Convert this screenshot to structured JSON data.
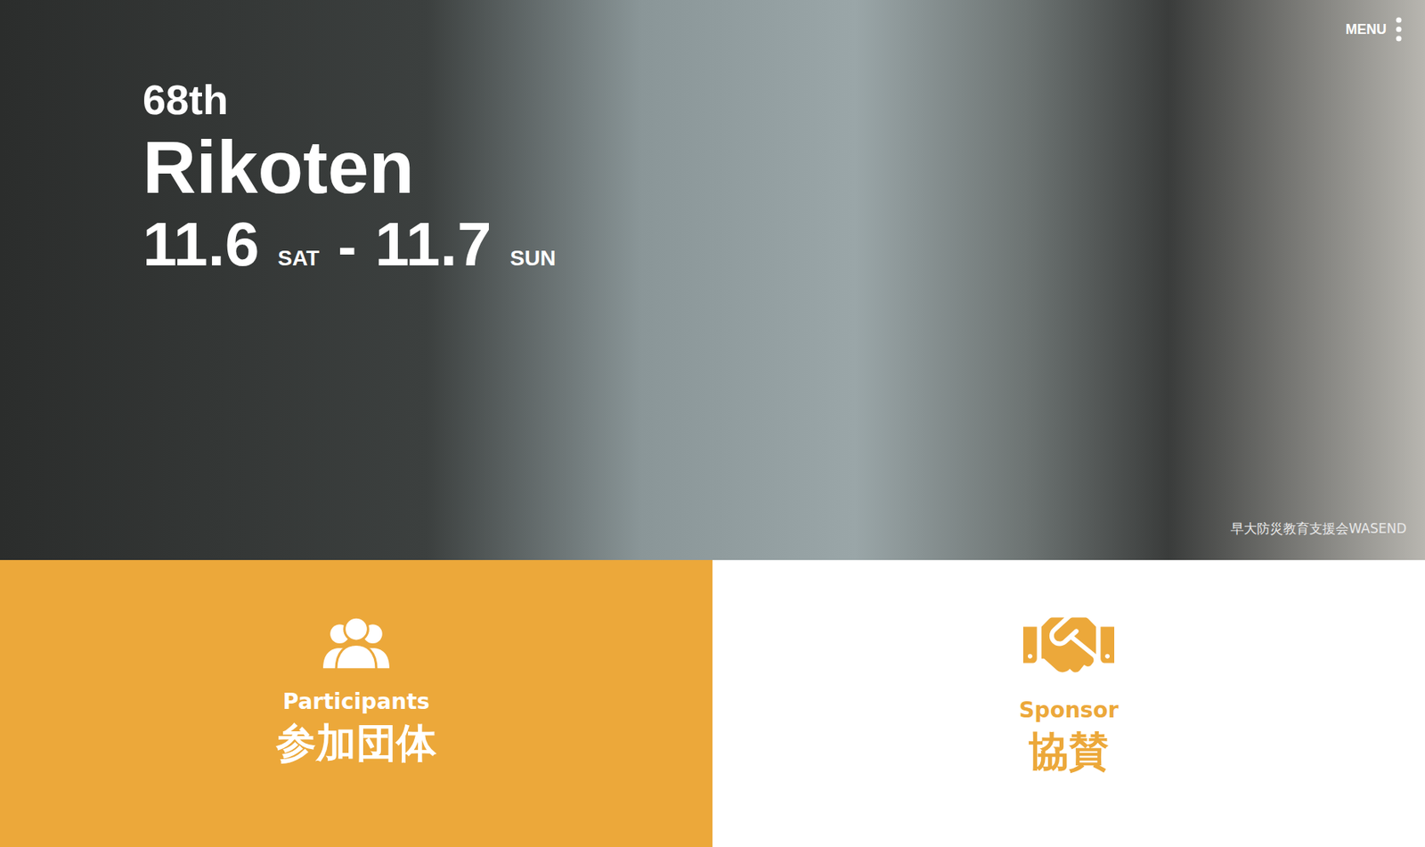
{
  "hero": {
    "edition": "68th",
    "title": "Rikoten",
    "dates": [
      {
        "date": "11.6",
        "day": "SAT"
      },
      {
        "date": "11.7",
        "day": "SUN"
      }
    ],
    "separator": "-",
    "photo_credit": "早大防災教育支援会WASEND"
  },
  "menu": {
    "label": "MENU"
  },
  "cards": [
    {
      "kind": "participants",
      "english": "Participants",
      "japanese": "参加団体",
      "selected": true
    },
    {
      "kind": "sponsor",
      "english": "Sponsor",
      "japanese": "協賛",
      "selected": false
    }
  ]
}
